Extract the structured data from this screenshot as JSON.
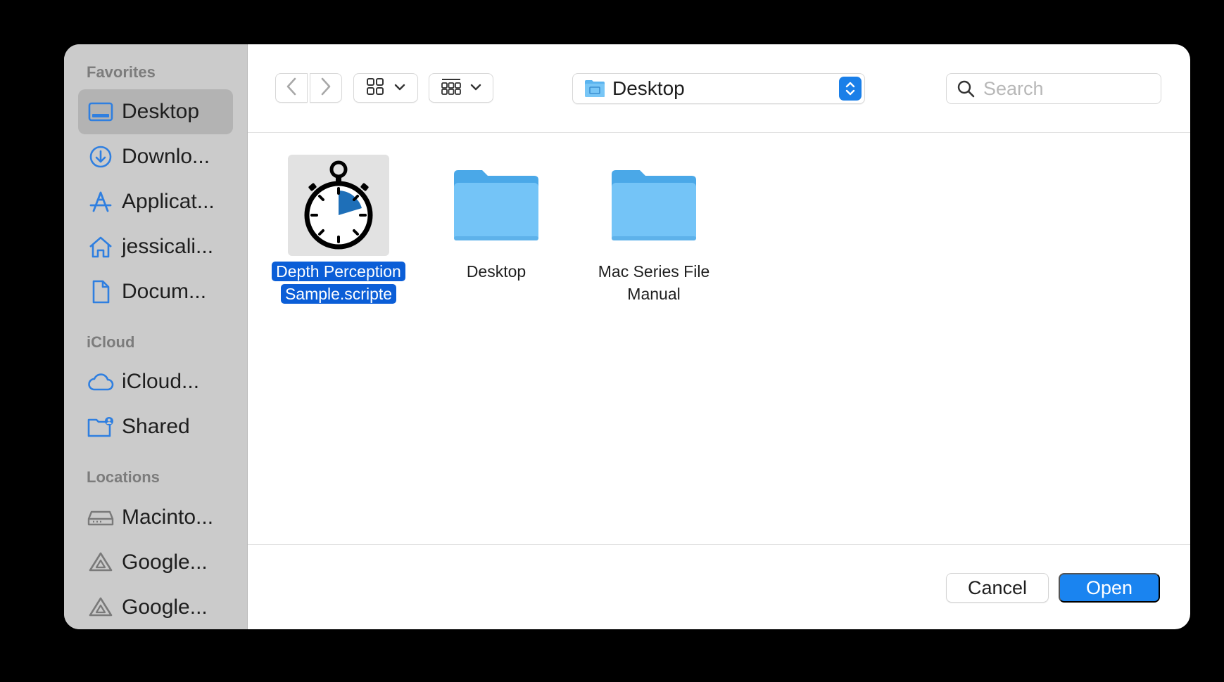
{
  "sidebar": {
    "sections": [
      {
        "title": "Favorites"
      },
      {
        "title": "iCloud"
      },
      {
        "title": "Locations"
      }
    ],
    "items": [
      {
        "label": "Desktop",
        "icon": "desktop-icon"
      },
      {
        "label": "Downlo...",
        "icon": "downloads-icon"
      },
      {
        "label": "Applicat...",
        "icon": "applications-icon"
      },
      {
        "label": "jessicali...",
        "icon": "home-icon"
      },
      {
        "label": "Docum...",
        "icon": "document-icon"
      },
      {
        "label": "iCloud...",
        "icon": "cloud-icon"
      },
      {
        "label": "Shared",
        "icon": "shared-folder-icon"
      },
      {
        "label": "Macinto...",
        "icon": "disk-icon"
      },
      {
        "label": "Google...",
        "icon": "google-drive-icon"
      },
      {
        "label": "Google...",
        "icon": "google-drive-icon"
      }
    ]
  },
  "toolbar": {
    "path_label": "Desktop",
    "search_placeholder": "Search"
  },
  "files": [
    {
      "name": "Depth Perception Sample.scripte",
      "icon": "stopwatch-icon",
      "selected": true
    },
    {
      "name": "Desktop",
      "icon": "folder-icon",
      "selected": false
    },
    {
      "name": "Mac Series File Manual",
      "icon": "folder-icon",
      "selected": false
    }
  ],
  "footer": {
    "cancel_label": "Cancel",
    "open_label": "Open"
  },
  "colors": {
    "accent": "#1a84f0",
    "selection": "#0b5ed7",
    "sidebar_icon": "#2f7fe0",
    "folder": "#6cc4f5"
  }
}
